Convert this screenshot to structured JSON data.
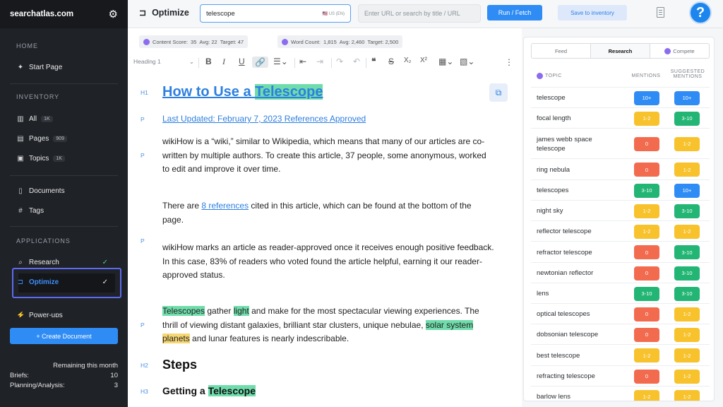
{
  "sidebar": {
    "brand": "searchatlas.com",
    "sections": {
      "home": "HOME",
      "inventory": "INVENTORY",
      "applications": "APPLICATIONS"
    },
    "start_page": "Start Page",
    "all": {
      "label": "All",
      "badge": "1K"
    },
    "pages": {
      "label": "Pages",
      "badge": "909"
    },
    "topics": {
      "label": "Topics",
      "badge": "1K"
    },
    "documents": "Documents",
    "tags": "Tags",
    "research": "Research",
    "optimize": "Optimize",
    "powerups": "Power-ups",
    "create_document": "+ Create Document",
    "remaining": "Remaining this month",
    "briefs": {
      "label": "Briefs:",
      "value": "10"
    },
    "planning": {
      "label": "Planning/Analysis:",
      "value": "3"
    }
  },
  "topbar": {
    "title": "Optimize",
    "keyword": "telescope",
    "locale": "🇺🇸 US (EN)",
    "url_placeholder": "Enter URL or search by title / URL",
    "run_label": "Run / Fetch",
    "save_label": "Save to inventory",
    "help": "?"
  },
  "scores": {
    "content": {
      "label": "Content Score:",
      "score": "35",
      "avg": "Avg: 22",
      "target": "Target: 47"
    },
    "words": {
      "label": "Word Count:",
      "score": "1,815",
      "avg": "Avg: 2,460",
      "target": "Target: 2,500"
    }
  },
  "toolbar": {
    "heading": "Heading 1"
  },
  "document": {
    "h1_prefix": "How to Use a ",
    "h1_keyword": "Telescope",
    "meta_updated": "Last Updated: February 7, 2023",
    "meta_references": "References",
    "meta_approved": "Approved",
    "p1": "wikiHow is a “wiki,” similar to Wikipedia, which means that many of our articles are co-written by multiple authors. To create this article, 37 people, some anonymous, worked to edit and improve it over time.",
    "p2_a": "There are ",
    "p2_link": "8 references",
    "p2_b": " cited in this article, which can be found at the bottom of the page.",
    "p3": "wikiHow marks an article as reader-approved once it receives enough positive feedback. In this case, 83% of readers who voted found the article helpful, earning it our reader-approved status.",
    "p4_telescopes": "Telescopes",
    "p4_gather": " gather ",
    "p4_light": "light",
    "p4_mid": " and make for the most spectacular viewing experiences. The thrill of viewing distant galaxies, brilliant star clusters, unique nebulae, ",
    "p4_solar": "solar system",
    "p4_sp": " ",
    "p4_planets": "planets",
    "p4_end": " and lunar features is nearly indescribable.",
    "h2": "Steps",
    "h3_prefix": "Getting a ",
    "h3_keyword": "Telescope",
    "tags": {
      "h1": "H1",
      "p": "P",
      "h2": "H2",
      "h3": "H3"
    }
  },
  "panel": {
    "tabs": [
      "Feed",
      "Research",
      "Compete"
    ],
    "col_topic": "TOPIC",
    "col_mentions": "MENTIONS",
    "col_suggested_1": "SUGGESTED",
    "col_suggested_2": "MENTIONS",
    "colors": {
      "blue": "#2f8cf5",
      "yellow": "#f7c22c",
      "red": "#f26b4f",
      "green": "#22b573"
    },
    "rows": [
      {
        "topic": "telescope",
        "mentions": "10+",
        "m_color": "blue",
        "suggested": "10+",
        "s_color": "blue"
      },
      {
        "topic": "focal length",
        "mentions": "1-2",
        "m_color": "yellow",
        "suggested": "3-10",
        "s_color": "green"
      },
      {
        "topic": "james webb space telescope",
        "mentions": "0",
        "m_color": "red",
        "suggested": "1-2",
        "s_color": "yellow"
      },
      {
        "topic": "ring nebula",
        "mentions": "0",
        "m_color": "red",
        "suggested": "1-2",
        "s_color": "yellow"
      },
      {
        "topic": "telescopes",
        "mentions": "3-10",
        "m_color": "green",
        "suggested": "10+",
        "s_color": "blue"
      },
      {
        "topic": "night sky",
        "mentions": "1-2",
        "m_color": "yellow",
        "suggested": "3-10",
        "s_color": "green"
      },
      {
        "topic": "reflector telescope",
        "mentions": "1-2",
        "m_color": "yellow",
        "suggested": "1-2",
        "s_color": "yellow"
      },
      {
        "topic": "refractor telescope",
        "mentions": "0",
        "m_color": "red",
        "suggested": "3-10",
        "s_color": "green"
      },
      {
        "topic": "newtonian reflector",
        "mentions": "0",
        "m_color": "red",
        "suggested": "3-10",
        "s_color": "green"
      },
      {
        "topic": "lens",
        "mentions": "3-10",
        "m_color": "green",
        "suggested": "3-10",
        "s_color": "green"
      },
      {
        "topic": "optical telescopes",
        "mentions": "0",
        "m_color": "red",
        "suggested": "1-2",
        "s_color": "yellow"
      },
      {
        "topic": "dobsonian telescope",
        "mentions": "0",
        "m_color": "red",
        "suggested": "1-2",
        "s_color": "yellow"
      },
      {
        "topic": "best telescope",
        "mentions": "1-2",
        "m_color": "yellow",
        "suggested": "1-2",
        "s_color": "yellow"
      },
      {
        "topic": "refracting telescope",
        "mentions": "0",
        "m_color": "red",
        "suggested": "1-2",
        "s_color": "yellow"
      },
      {
        "topic": "barlow lens",
        "mentions": "1-2",
        "m_color": "yellow",
        "suggested": "1-2",
        "s_color": "yellow"
      }
    ]
  }
}
